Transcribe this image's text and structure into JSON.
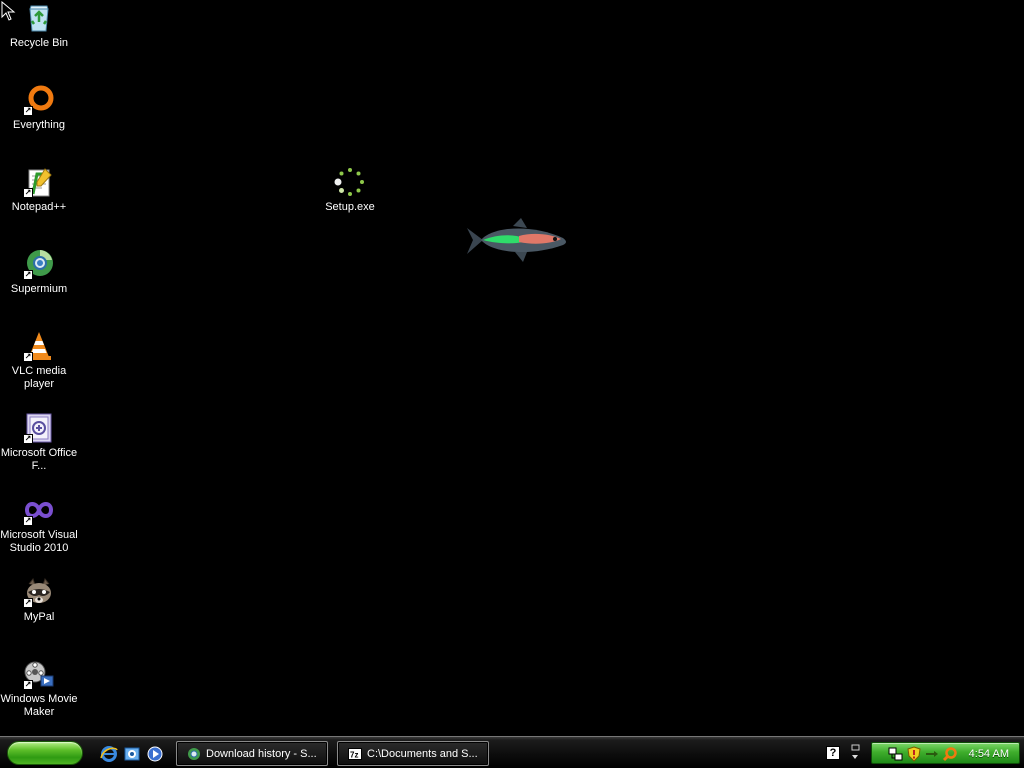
{
  "desktop": {
    "background_color": "#000000",
    "icons": [
      {
        "label": "Recycle Bin",
        "icon": "recycle-bin-icon"
      },
      {
        "label": "Everything",
        "icon": "everything-search-icon"
      },
      {
        "label": "Notepad++",
        "icon": "notepad-plus-plus-icon"
      },
      {
        "label": "Supermium",
        "icon": "supermium-browser-icon"
      },
      {
        "label": "VLC media player",
        "icon": "vlc-cone-icon"
      },
      {
        "label": "Microsoft Office F...",
        "icon": "office-file-icon"
      },
      {
        "label": "Microsoft Visual Studio 2010",
        "icon": "visual-studio-icon"
      },
      {
        "label": "MyPal",
        "icon": "mypal-raccoon-icon"
      },
      {
        "label": "Windows Movie Maker",
        "icon": "movie-maker-icon"
      },
      {
        "label": "Setup.exe",
        "icon": "loading-spinner-icon"
      }
    ]
  },
  "taskbar": {
    "quick_launch": [
      {
        "icon": "internet-explorer-icon"
      },
      {
        "icon": "show-desktop-icon"
      },
      {
        "icon": "media-player-icon"
      }
    ],
    "buttons": [
      {
        "label": "Download history - S...",
        "icon": "browser-icon"
      },
      {
        "label": "C:\\Documents and S...",
        "icon": "7zip-icon"
      }
    ],
    "help_icon": "?",
    "tray": {
      "icons": [
        "network-icon",
        "security-shield-icon",
        "arrow-icon",
        "search-tray-icon"
      ],
      "clock": "4:54 AM"
    }
  },
  "colors": {
    "start_green": "#3fae2c",
    "tray_green": "#3fae2c",
    "taskbar_black": "#0d0d0d"
  }
}
